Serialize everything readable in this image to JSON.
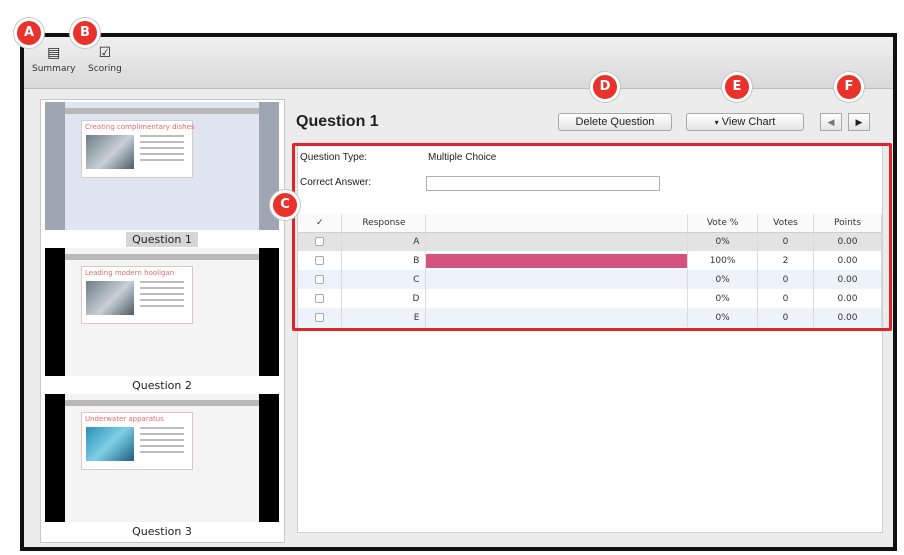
{
  "toolbar": {
    "summary_label": "Summary",
    "summary_icon": "summary-icon",
    "scoring_label": "Scoring",
    "scoring_icon": "scoring-checkbox-icon"
  },
  "slides": [
    {
      "title": "Creating complimentary dishes",
      "label": "Question 1",
      "selected": true
    },
    {
      "title": "Leading modern hooligan",
      "label": "Question 2",
      "selected": false
    },
    {
      "title": "Underwater apparatus",
      "label": "Question 3",
      "selected": false
    }
  ],
  "question": {
    "title": "Question 1",
    "delete_label": "Delete Question",
    "view_chart_label": "View Chart",
    "prev_icon": "prev-arrow-icon",
    "next_icon": "next-arrow-icon",
    "type_label": "Question Type:",
    "type_value": "Multiple Choice",
    "answer_label": "Correct Answer:",
    "answer_value": ""
  },
  "table": {
    "headers": {
      "check": "✓",
      "response": "Response",
      "bar": "",
      "vote_pct": "Vote %",
      "votes": "Votes",
      "points": "Points"
    },
    "rows": [
      {
        "response": "A",
        "vote_pct": "0%",
        "votes": "0",
        "points": "0.00",
        "share": 0
      },
      {
        "response": "B",
        "vote_pct": "100%",
        "votes": "2",
        "points": "0.00",
        "share": 1
      },
      {
        "response": "C",
        "vote_pct": "0%",
        "votes": "0",
        "points": "0.00",
        "share": 0
      },
      {
        "response": "D",
        "vote_pct": "0%",
        "votes": "0",
        "points": "0.00",
        "share": 0
      },
      {
        "response": "E",
        "vote_pct": "0%",
        "votes": "0",
        "points": "0.00",
        "share": 0
      }
    ]
  },
  "callouts": {
    "a": "A",
    "b": "B",
    "c": "C",
    "d": "D",
    "e": "E",
    "f": "F"
  },
  "colors": {
    "callout": "#e8322b",
    "highlight_box": "#e0242e",
    "vote_bar": "#d4537e"
  }
}
